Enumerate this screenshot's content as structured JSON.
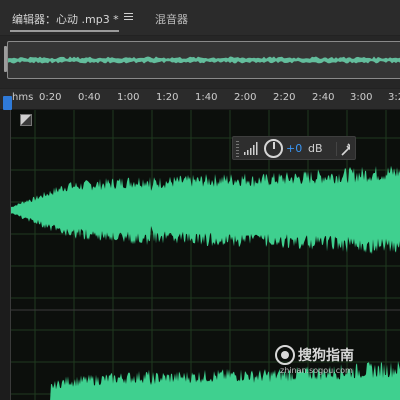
{
  "tabs": {
    "editor_label": "编辑器：心动 .mp3 *",
    "mixer_label": "混音器"
  },
  "ruler": {
    "unit_label": "hms",
    "ticks": [
      "0:20",
      "0:40",
      "1:00",
      "1:20",
      "1:40",
      "2:00",
      "2:20",
      "2:40",
      "3:00",
      "3:2"
    ]
  },
  "volume_hud": {
    "value": "+0",
    "unit": "dB"
  },
  "watermark": {
    "brand": "搜狗指南",
    "url": "zhinan.sogou.com"
  },
  "colors": {
    "waveform": "#3fd08f",
    "overview_wave": "#6fe0b6",
    "playhead": "#2f7ad8",
    "accent_value": "#3a95f2",
    "grid": "#1f3a1f"
  },
  "icons": {
    "tab_menu": "hamburger-menu-icon",
    "volume_bars": "volume-bars-icon",
    "volume_knob": "volume-knob-icon",
    "pin": "pin-icon",
    "zoom_corner": "zoom-navigator-icon"
  }
}
